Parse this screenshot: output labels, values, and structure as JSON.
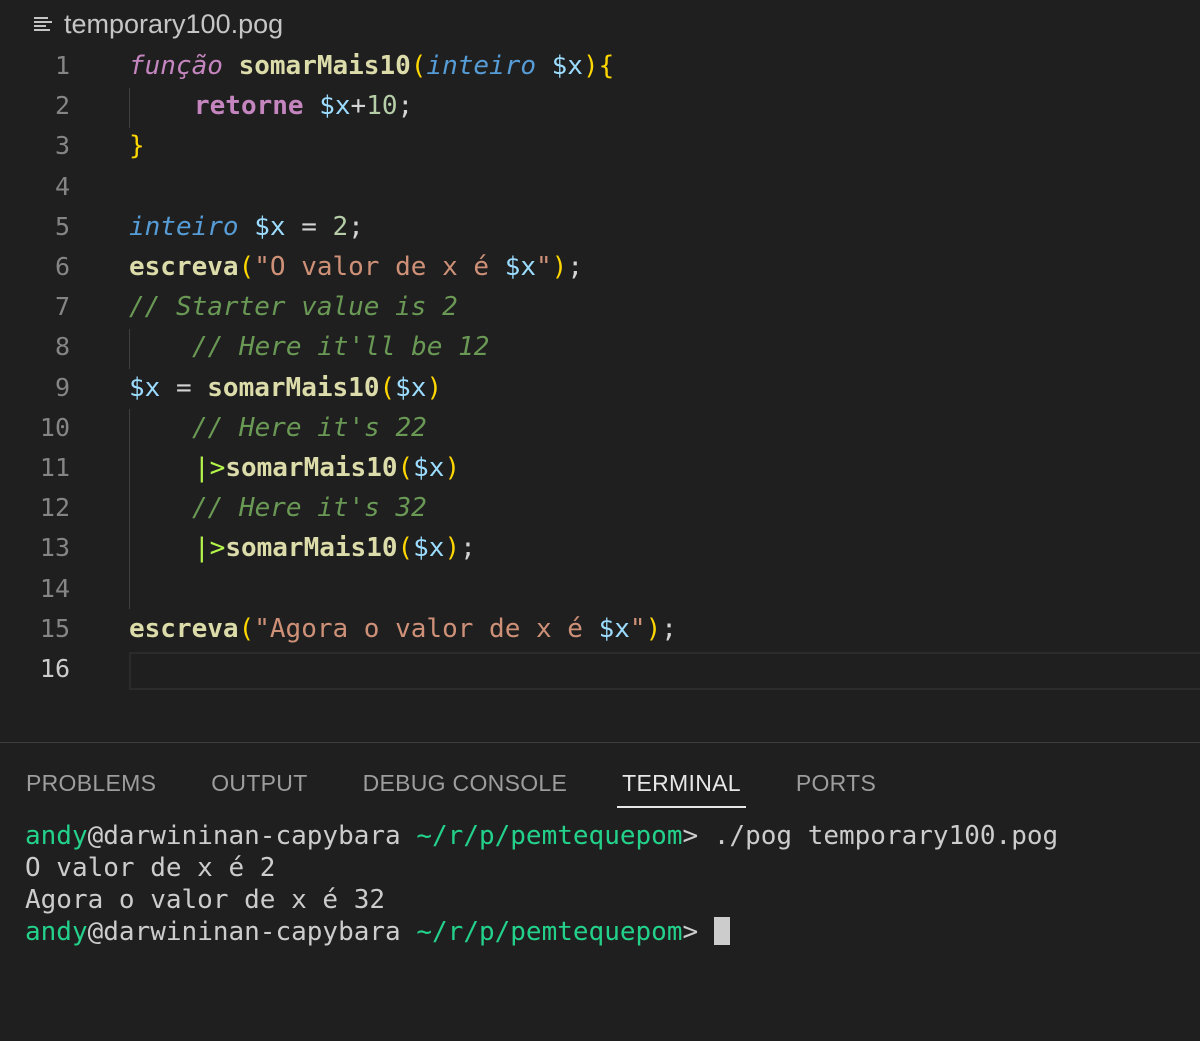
{
  "breadcrumb": {
    "file_name": "temporary100.pog",
    "icon": "symbol-file-icon"
  },
  "editor": {
    "active_line": "16",
    "line_numbers": [
      "1",
      "2",
      "3",
      "4",
      "5",
      "6",
      "7",
      "8",
      "9",
      "10",
      "11",
      "12",
      "13",
      "14",
      "15",
      "16"
    ],
    "tokens": {
      "l1": [
        "função",
        " ",
        "somarMais10",
        "(",
        "inteiro",
        " ",
        "$x",
        ")",
        "{"
      ],
      "l2": [
        "retorne",
        " ",
        "$x",
        "+",
        "10",
        ";"
      ],
      "l3": [
        "}"
      ],
      "l5": [
        "inteiro",
        " ",
        "$x",
        " = ",
        "2",
        ";"
      ],
      "l6": [
        "escreva",
        "(",
        "\"O valor de x é ",
        "$x",
        "\"",
        ")",
        ";"
      ],
      "l7": [
        "// Starter value is 2"
      ],
      "l8": [
        "// Here it'll be 12"
      ],
      "l9": [
        "$x",
        " = ",
        "somarMais10",
        "(",
        "$x",
        ")"
      ],
      "l10": [
        "// Here it's 22"
      ],
      "l11": [
        "|>",
        "somarMais10",
        "(",
        "$x",
        ")"
      ],
      "l12": [
        "// Here it's 32"
      ],
      "l13": [
        "|>",
        "somarMais10",
        "(",
        "$x",
        ")",
        ";"
      ],
      "l15": [
        "escreva",
        "(",
        "\"Agora o valor de x é ",
        "$x",
        "\"",
        ")",
        ";"
      ]
    }
  },
  "panel": {
    "tabs": [
      "PROBLEMS",
      "OUTPUT",
      "DEBUG CONSOLE",
      "TERMINAL",
      "PORTS"
    ],
    "active_tab": "TERMINAL"
  },
  "terminal": {
    "user": "andy",
    "at_host": "@darwininan-capybara",
    "path": "~/r/p/pemtequepom",
    "prompt_char": ">",
    "command": " ./pog temporary100.pog",
    "output": [
      "O valor de x é 2",
      "Agora o valor de x é 32"
    ]
  }
}
